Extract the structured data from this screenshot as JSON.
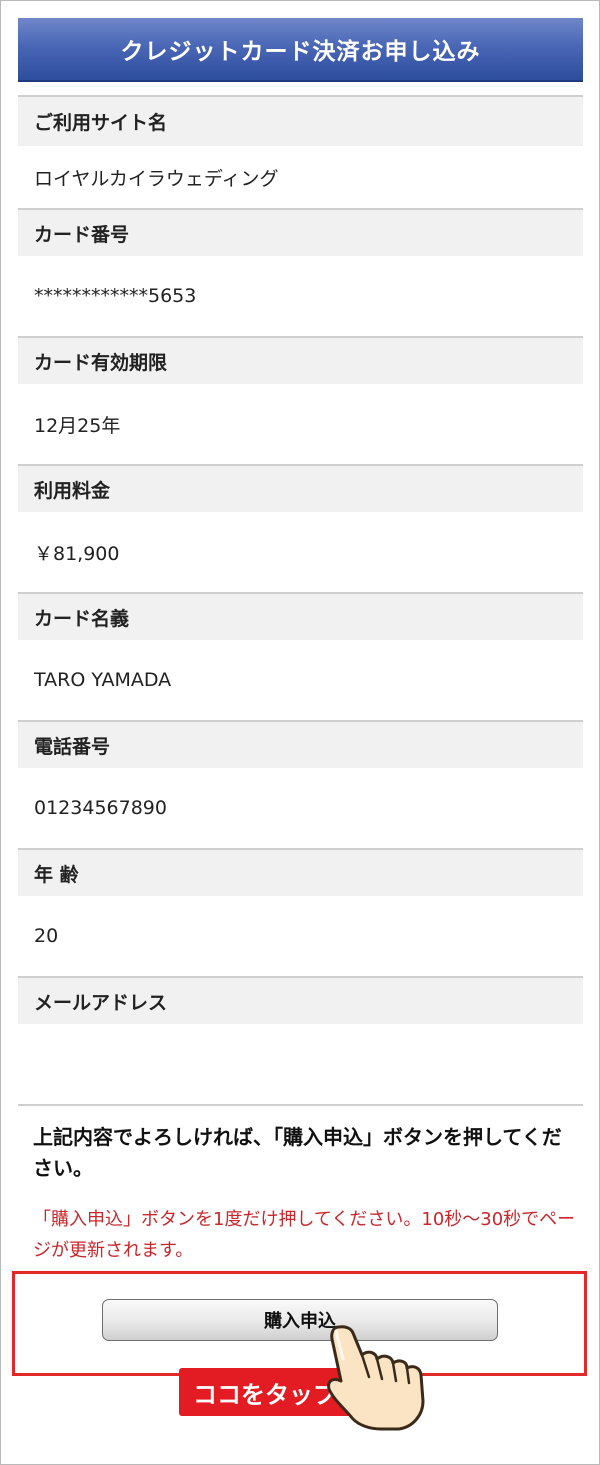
{
  "header": {
    "title": "クレジットカード決済お申し込み"
  },
  "fields": [
    {
      "label": "ご利用サイト名",
      "value": "ロイヤルカイラウェディング"
    },
    {
      "label": "カード番号",
      "value": "************5653"
    },
    {
      "label": "カード有効期限",
      "value": "12月25年"
    },
    {
      "label": "利用料金",
      "value": "￥81,900"
    },
    {
      "label": "カード名義",
      "value": "TARO YAMADA"
    },
    {
      "label": "電話番号",
      "value": "01234567890"
    },
    {
      "label": "年 齢",
      "value": "20"
    },
    {
      "label": "メールアドレス",
      "value": ""
    }
  ],
  "instruction": "上記内容でよろしければ、「購入申込」ボタンを押してください。",
  "note": "「購入申込」ボタンを1度だけ押してください。10秒〜30秒でページが更新されます。",
  "buy_button": {
    "label": "購入申込"
  },
  "tap_hint": {
    "label": "ココをタップ",
    "icon": "pointing-hand-icon"
  },
  "colors": {
    "header": "#3f5cab",
    "note": "#c8272b",
    "highlight": "#e02a2a",
    "badge": "#e31b22"
  }
}
